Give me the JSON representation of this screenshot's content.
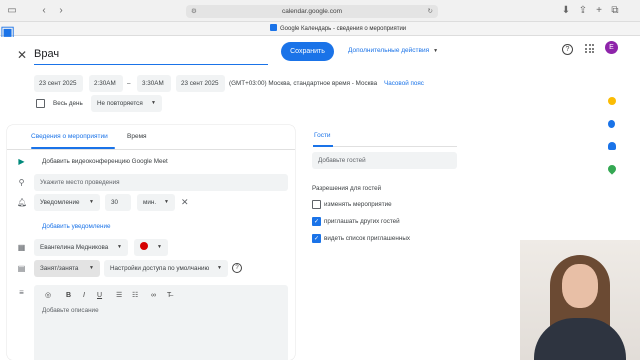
{
  "browser": {
    "url": "calendar.google.com",
    "tab_title": "Google Календарь - сведения о мероприятии"
  },
  "header": {
    "event_title": "Врач",
    "save_label": "Сохранить",
    "more_actions_label": "Дополнительные действия",
    "avatar_letter": "E"
  },
  "datetime": {
    "start_date": "23 сент 2025",
    "start_time": "2:30AM",
    "separator": "–",
    "end_time": "3:30AM",
    "end_date": "23 сент 2025",
    "timezone": "(GMT+03:00) Москва, стандартное время - Москва",
    "timezone_link": "Часовой пояс",
    "all_day_label": "Весь день",
    "repeat_label": "Не повторяется"
  },
  "tabs": {
    "details": "Сведения о мероприятии",
    "time": "Время"
  },
  "details": {
    "meet_label": "Добавить видеоконференцию Google Meet",
    "location_placeholder": "Укажите место проведения",
    "notification_type": "Уведомление",
    "notification_value": "30",
    "notification_unit": "мин.",
    "add_notification": "Добавить уведомление",
    "calendar_owner": "Евангелина Медникова",
    "busy_label": "Занят/занята",
    "visibility_label": "Настройки доступа по умолчанию",
    "description_placeholder": "Добавьте описание",
    "event_color": "#d50000"
  },
  "guests": {
    "tab_label": "Гости",
    "input_placeholder": "Добавьте гостей",
    "permissions_title": "Разрешения для гостей",
    "permissions": [
      {
        "label": "изменять мероприятие",
        "checked": false
      },
      {
        "label": "приглашать других гостей",
        "checked": true
      },
      {
        "label": "видеть список приглашенных",
        "checked": true
      }
    ]
  },
  "colors": {
    "accent": "#1a73e8",
    "avatar": "#8e24aa"
  }
}
